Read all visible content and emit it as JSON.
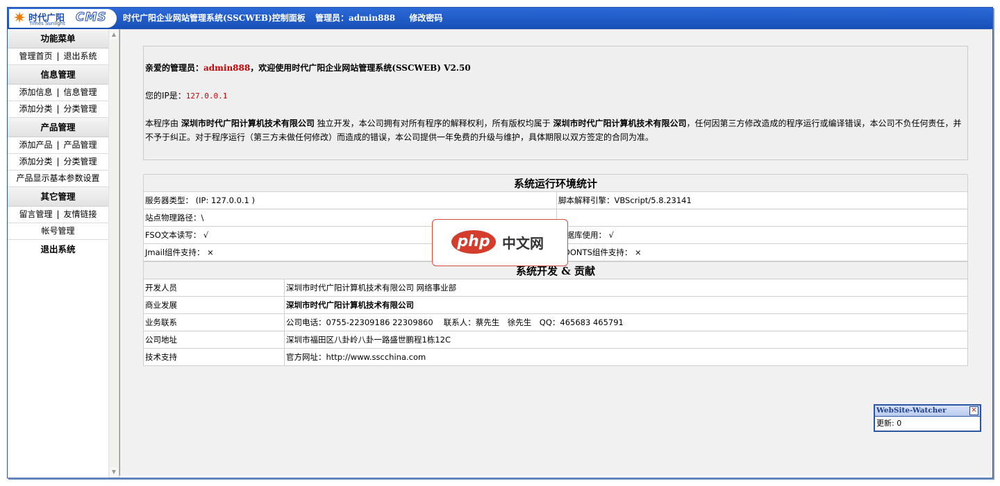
{
  "header": {
    "logo_cn": "时代广阳",
    "logo_en": "Times Sunlight",
    "logo_cms": "CMS",
    "title": "时代广阳企业网站管理系统(SSCWEB)控制面板",
    "admin_label": "管理员：",
    "admin_name": "admin888",
    "change_password": "修改密码"
  },
  "sidebar": {
    "menu_title": "功能菜单",
    "home": "管理首页",
    "logout_link": "退出系统",
    "info_title": "信息管理",
    "add_info": "添加信息",
    "info_manage": "信息管理",
    "add_category_info": "添加分类",
    "category_manage_info": "分类管理",
    "product_title": "产品管理",
    "add_product": "添加产品",
    "product_manage": "产品管理",
    "add_category_product": "添加分类",
    "category_manage_product": "分类管理",
    "product_params": "产品显示基本参数设置",
    "other_title": "其它管理",
    "guestbook": "留言管理",
    "friend_links": "友情链接",
    "account_manage": "帐号管理",
    "logout": "退出系统",
    "separator": "|"
  },
  "welcome": {
    "greeting_prefix": "亲爱的管理员：",
    "admin_name": "admin888",
    "greeting_suffix": "，欢迎使用时代广阳企业网站管理系统(SSCWEB) V2.50",
    "ip_label": "您的IP是：",
    "ip_value": "127.0.0.1",
    "notice_1": "本程序由 ",
    "company": "深圳市时代广阳计算机技术有限公司",
    "notice_2": " 独立开发，本公司拥有对所有程序的解释权利，所有版权均属于 ",
    "notice_3": "，任何因第三方修改造成的程序运行或编译错误，本公司不负任何责任，并不予于纠正。对于程序运行（第三方未做任何修改）而造成的错误，本公司提供一年免费的升级与维护，具体期限以双方签定的合同为准。"
  },
  "env": {
    "title": "系统运行环境统计",
    "server_type": "服务器类型： (IP: 127.0.0.1 )",
    "script_engine": "脚本解释引擎：VBScript/5.8.23141",
    "physical_path": "站点物理路径：\\",
    "fso": "FSO文本读写： √",
    "database": "数据库使用： √",
    "jmail": "Jmail组件支持： ×",
    "cdonts": "CDONTS组件支持： ×"
  },
  "dev": {
    "title": "系统开发 & 贡献",
    "rows": [
      {
        "label": "开发人员",
        "value": "深圳市时代广阳计算机技术有限公司 网络事业部"
      },
      {
        "label": "商业发展",
        "value": "深圳市时代广阳计算机技术有限公司"
      },
      {
        "label": "业务联系",
        "value": "公司电话：0755-22309186 22309860　 联系人：蔡先生　徐先生　QQ：465683 465791"
      },
      {
        "label": "公司地址",
        "value": "深圳市福田区八卦岭八卦一路盛世鹏程1栋12C"
      },
      {
        "label": "技术支持",
        "value": "官方网址：http://www.sscchina.com"
      }
    ]
  },
  "watermark": {
    "pill": "php",
    "text": "中文网"
  },
  "watcher": {
    "title": "WebSite-Watcher",
    "close": "×",
    "update": "更新: 0"
  },
  "icons": {
    "logo": "sun-icon",
    "scroll_up": "scroll-up-arrow-icon",
    "scroll_down": "scroll-down-arrow-icon",
    "close": "close-icon"
  },
  "colors": {
    "header_blue": "#1c55c0",
    "accent_red": "#cc0000",
    "panel_gray": "#efefef"
  }
}
